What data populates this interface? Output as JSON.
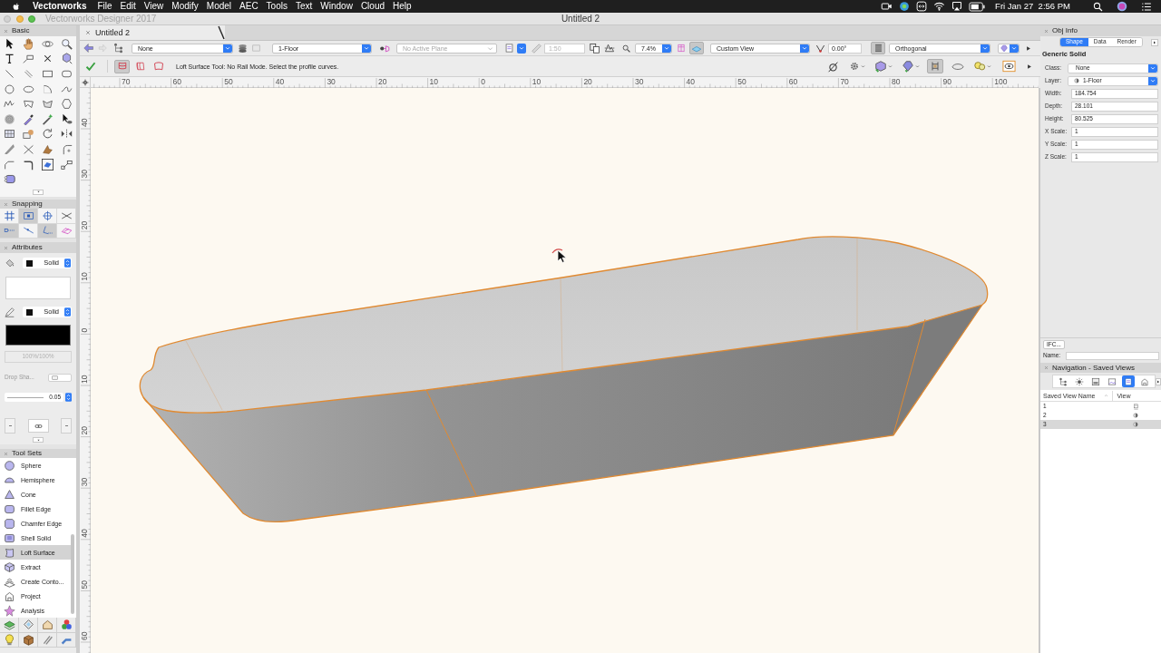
{
  "menu_bar": {
    "app": "Vectorworks",
    "menus": [
      "File",
      "Edit",
      "View",
      "Modify",
      "Model",
      "AEC",
      "Tools",
      "Text",
      "Window",
      "Cloud",
      "Help"
    ],
    "clock": "Fri Jan 27  2:56 PM"
  },
  "window": {
    "app_title": "Vectorworks Designer 2017",
    "title": "Untitled 2"
  },
  "doc_tabs": [
    {
      "label": "Untitled 2",
      "selected": true
    }
  ],
  "view_bar": {
    "class": "None",
    "layer": "1-Floor",
    "plane": "No Active Plane",
    "scale": "1:50",
    "zoom": "7.4%",
    "view": "Custom View",
    "rotation": "0.00°",
    "projection": "Orthogonal",
    "toggles": [
      {
        "on": true
      },
      {
        "on": true
      }
    ]
  },
  "mode_bar": {
    "modes": [
      {
        "selected": true
      },
      {
        "selected": false
      },
      {
        "selected": false
      }
    ],
    "message": "Loft Surface Tool: No Rail Mode. Select the profile curves.",
    "toggles": [
      {
        "on": true
      }
    ]
  },
  "rulers": {
    "horizontal": [
      "70",
      "60",
      "50",
      "40",
      "30",
      "20",
      "10",
      "0",
      "10",
      "20",
      "30",
      "40",
      "50",
      "60",
      "70",
      "80",
      "90",
      "100"
    ],
    "vertical": [
      "40",
      "30",
      "20",
      "10",
      "0",
      "10",
      "20",
      "30",
      "40",
      "50",
      "60"
    ]
  },
  "basic_palette": {
    "title": "Basic"
  },
  "snapping_palette": {
    "title": "Snapping",
    "snaps": [
      {
        "on": false
      },
      {
        "on": true
      },
      {
        "on": false
      },
      {
        "on": false
      },
      {
        "on": true
      },
      {
        "on": false
      },
      {
        "on": true
      },
      {
        "on": false
      }
    ]
  },
  "attributes_palette": {
    "title": "Attributes",
    "fill_style": "Solid",
    "pen_style": "Solid",
    "opacity": "100%/100%",
    "drop_shadow": "Drop Sha...",
    "line_weight": "0.05"
  },
  "tool_sets_palette": {
    "title": "Tool Sets",
    "tools": [
      {
        "label": "Sphere",
        "selected": false
      },
      {
        "label": "Hemisphere",
        "selected": false
      },
      {
        "label": "Cone",
        "selected": false
      },
      {
        "label": "Fillet Edge",
        "selected": false
      },
      {
        "label": "Chamfer Edge",
        "selected": false
      },
      {
        "label": "Shell Solid",
        "selected": false
      },
      {
        "label": "Loft Surface",
        "selected": true
      },
      {
        "label": "Extract",
        "selected": false
      },
      {
        "label": "Create Conto...",
        "selected": false
      },
      {
        "label": "Project",
        "selected": false
      },
      {
        "label": "Analysis",
        "selected": false
      }
    ]
  },
  "obj_info": {
    "title": "Obj Info",
    "tabs": [
      {
        "label": "Shape",
        "selected": true
      },
      {
        "label": "Data",
        "selected": false
      },
      {
        "label": "Render",
        "selected": false
      }
    ],
    "object_type": "Generic Solid",
    "fields": [
      {
        "label": "Class:",
        "value": "None",
        "kind": "dropdown"
      },
      {
        "label": "Layer:",
        "value": "1-Floor",
        "kind": "layer"
      },
      {
        "label": "Width:",
        "value": "184.754",
        "kind": "text"
      },
      {
        "label": "Depth:",
        "value": "28.101",
        "kind": "text"
      },
      {
        "label": "Height:",
        "value": "80.525",
        "kind": "text"
      },
      {
        "label": "X Scale:",
        "value": "1",
        "kind": "text"
      },
      {
        "label": "Y Scale:",
        "value": "1",
        "kind": "text"
      },
      {
        "label": "Z Scale:",
        "value": "1",
        "kind": "text"
      }
    ],
    "ifc_button": "IFC...",
    "name_label": "Name:"
  },
  "navigation": {
    "title": "Navigation - Saved Views",
    "tools": [
      {
        "selected": false
      },
      {
        "selected": false
      },
      {
        "selected": false
      },
      {
        "selected": false
      },
      {
        "selected": true
      },
      {
        "selected": false
      }
    ],
    "columns": [
      "Saved View Name",
      "View"
    ],
    "rows": [
      {
        "name": "1",
        "kind": "plan",
        "selected": false
      },
      {
        "name": "2",
        "kind": "perspective",
        "selected": false
      },
      {
        "name": "3",
        "kind": "perspective",
        "selected": true
      }
    ]
  }
}
